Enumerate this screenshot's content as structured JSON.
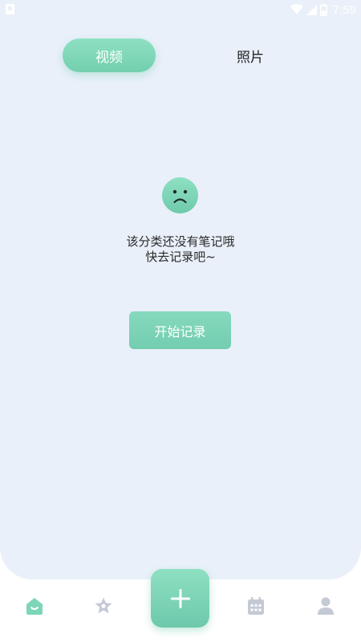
{
  "status_bar": {
    "time": "7:59",
    "icons": [
      "app-notification-icon",
      "wifi-icon",
      "signal-icon",
      "battery-icon"
    ]
  },
  "tabs": [
    {
      "label": "视频",
      "active": true
    },
    {
      "label": "照片",
      "active": false
    }
  ],
  "empty_state": {
    "icon": "sad-face-icon",
    "line1": "该分类还没有笔记哦",
    "line2": "快去记录吧~",
    "button_label": "开始记录"
  },
  "bottom_nav": {
    "items": [
      {
        "icon": "home-icon",
        "active": true
      },
      {
        "icon": "star-icon",
        "active": false
      },
      {
        "icon": "add-icon",
        "primary": true
      },
      {
        "icon": "calendar-icon",
        "active": false
      },
      {
        "icon": "profile-icon",
        "active": false
      }
    ]
  },
  "colors": {
    "accent": "#7ed6b8",
    "panel_background": "#e9f0f9",
    "inactive_icon": "#c4c9d6",
    "text_dark": "#2a2a2a"
  }
}
